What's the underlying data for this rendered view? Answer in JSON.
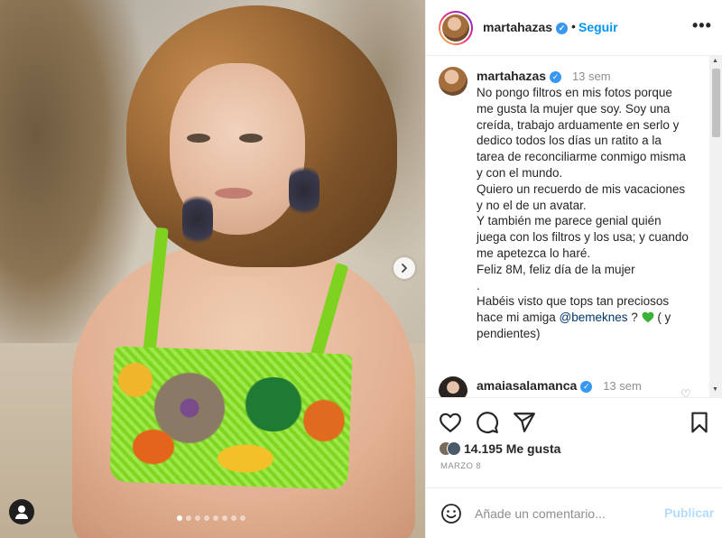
{
  "post": {
    "slide_count": 8,
    "active_slide": 1
  },
  "header": {
    "username": "martahazas",
    "separator": "•",
    "follow_label": "Seguir",
    "more_label": "•••"
  },
  "caption": {
    "username": "martahazas",
    "time": "13 sem",
    "lines": [
      "No pongo filtros en mis fotos porque",
      "me gusta la mujer que soy. Soy una",
      "creída, trabajo arduamente en serlo y",
      "dedico todos los días un ratito a la",
      "tarea de reconciliarme conmigo misma",
      "y con el mundo.",
      "Quiero un recuerdo de mis vacaciones",
      "y no el de un avatar.",
      "Y también me parece genial quién",
      "juega con los filtros y los usa; y cuando",
      "me apetezca lo haré.",
      "Feliz 8M, feliz día de la mujer",
      ".",
      "Habéis visto que tops tan preciosos"
    ],
    "last_line_before": "hace mi amiga ",
    "mention": "@bemeknes",
    "last_line_after": " ? ",
    "last_line_tail": " ( y",
    "final_line": "pendientes)"
  },
  "comment2": {
    "username": "amaiasalamanca",
    "time": "13 sem"
  },
  "likes": {
    "text": "14.195 Me gusta"
  },
  "date": "MARZO 8",
  "add_comment": {
    "placeholder": "Añade un comentario...",
    "publish_label": "Publicar"
  },
  "colors": {
    "accent": "#0095f6",
    "verified": "#3897f0",
    "publish_disabled": "#b3dbff",
    "heart_green": "#3bb33b"
  }
}
